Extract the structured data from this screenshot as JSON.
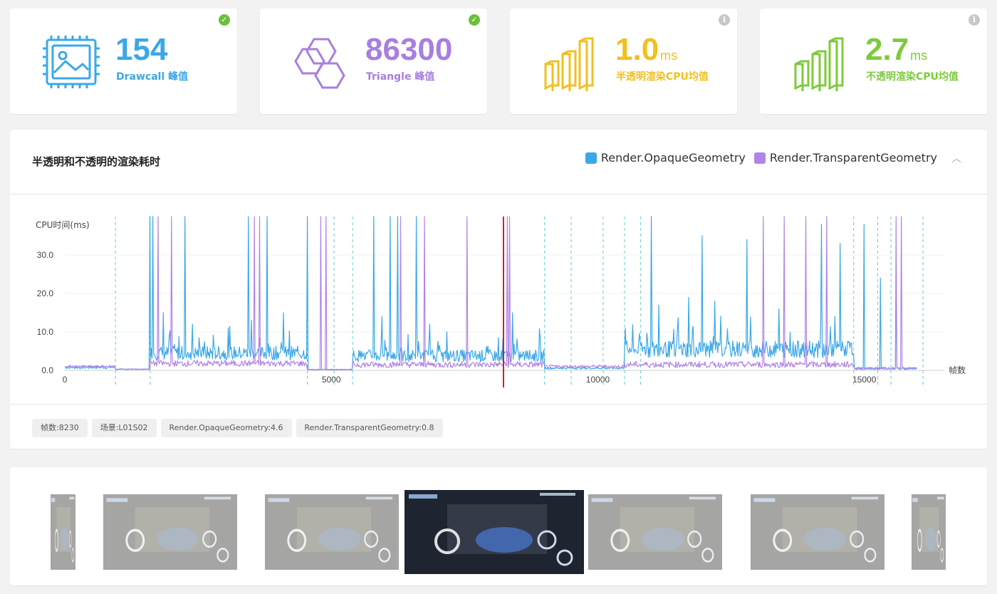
{
  "stats": [
    {
      "value": "154",
      "unit": "",
      "label": "Drawcall 峰值",
      "color": "#3aa8e8",
      "badge": "ok",
      "icon": "image-chip-icon"
    },
    {
      "value": "86300",
      "unit": "",
      "label": "Triangle 峰值",
      "color": "#a87fe0",
      "badge": "ok",
      "icon": "hexagon-cluster-icon"
    },
    {
      "value": "1.0",
      "unit": "ms",
      "label": "半透明渲染CPU均值",
      "color": "#f0c020",
      "badge": "info",
      "icon": "bar-graph-icon"
    },
    {
      "value": "2.7",
      "unit": "ms",
      "label": "不透明渲染CPU均值",
      "color": "#7ccb3a",
      "badge": "info",
      "icon": "bar-graph-icon"
    }
  ],
  "chart": {
    "title": "半透明和不透明的渲染耗时",
    "legend": [
      "Render.OpaqueGeometry",
      "Render.TransparentGeometry"
    ],
    "colors": {
      "opaque": "#3aa8e8",
      "transparent": "#b084e8",
      "marker": "#d42020",
      "dashed": "#5ed0c8"
    }
  },
  "chart_data": {
    "type": "line",
    "ylabel": "CPU时间(ms)",
    "xlabel": "帧数",
    "ylim": [
      0,
      40
    ],
    "xlim": [
      0,
      16000
    ],
    "yticks": [
      "0.0",
      "10.0",
      "20.0",
      "30.0"
    ],
    "xticks": [
      "0",
      "5000",
      "10000",
      "15000"
    ],
    "marker_x": 8230,
    "scene_boundaries": [
      950,
      1600,
      9500,
      4550,
      5050,
      5400,
      9000,
      10100,
      10500,
      10800,
      14800,
      15250,
      15500,
      16100
    ],
    "series": [
      {
        "name": "Render.OpaqueGeometry",
        "segments": [
          {
            "start": 0,
            "end": 950,
            "base": 0.8,
            "noise": 0.4
          },
          {
            "start": 950,
            "end": 1600,
            "base": 0.3,
            "noise": 0.1
          },
          {
            "start": 1600,
            "end": 4550,
            "base": 4.5,
            "noise": 1.8
          },
          {
            "start": 4550,
            "end": 5400,
            "base": 0.2,
            "noise": 0.1
          },
          {
            "start": 5400,
            "end": 9000,
            "base": 3.8,
            "noise": 1.6
          },
          {
            "start": 9000,
            "end": 10500,
            "base": 0.6,
            "noise": 0.3
          },
          {
            "start": 10500,
            "end": 14800,
            "base": 5.5,
            "noise": 2.2
          },
          {
            "start": 14800,
            "end": 16000,
            "base": 0.5,
            "noise": 0.3
          }
        ],
        "spikes": [
          [
            1600,
            40
          ],
          [
            1650,
            40
          ],
          [
            1850,
            15
          ],
          [
            2250,
            40
          ],
          [
            2400,
            12
          ],
          [
            3450,
            40
          ],
          [
            3500,
            13
          ],
          [
            3800,
            40
          ],
          [
            4100,
            15
          ],
          [
            4550,
            40
          ],
          [
            5800,
            40
          ],
          [
            5950,
            14
          ],
          [
            6100,
            40
          ],
          [
            6250,
            40
          ],
          [
            6600,
            40
          ],
          [
            6850,
            12
          ],
          [
            8400,
            15
          ],
          [
            11000,
            40
          ],
          [
            11150,
            17
          ],
          [
            11500,
            11
          ],
          [
            11700,
            19
          ],
          [
            11950,
            35
          ],
          [
            12200,
            18
          ],
          [
            12800,
            34
          ],
          [
            13400,
            16
          ],
          [
            14200,
            38
          ],
          [
            14550,
            33
          ],
          [
            15000,
            38
          ],
          [
            15300,
            24
          ],
          [
            15600,
            24
          ],
          [
            16150,
            18
          ]
        ]
      },
      {
        "name": "Render.TransparentGeometry",
        "segments": [
          {
            "start": 0,
            "end": 950,
            "base": 1.0,
            "noise": 0.3
          },
          {
            "start": 950,
            "end": 1600,
            "base": 0.3,
            "noise": 0.1
          },
          {
            "start": 1600,
            "end": 4550,
            "base": 1.8,
            "noise": 0.8
          },
          {
            "start": 4550,
            "end": 5400,
            "base": 0.2,
            "noise": 0.1
          },
          {
            "start": 5400,
            "end": 9000,
            "base": 1.5,
            "noise": 0.8
          },
          {
            "start": 9000,
            "end": 10500,
            "base": 1.0,
            "noise": 0.4
          },
          {
            "start": 10500,
            "end": 14800,
            "base": 1.5,
            "noise": 0.8
          },
          {
            "start": 14800,
            "end": 16000,
            "base": 0.5,
            "noise": 0.3
          }
        ],
        "spikes": [
          [
            1750,
            40
          ],
          [
            2000,
            40
          ],
          [
            3550,
            40
          ],
          [
            3650,
            40
          ],
          [
            4800,
            40
          ],
          [
            4900,
            40
          ],
          [
            6300,
            40
          ],
          [
            6750,
            40
          ],
          [
            7550,
            40
          ],
          [
            8300,
            40
          ],
          [
            8350,
            40
          ],
          [
            13100,
            40
          ],
          [
            13500,
            40
          ],
          [
            13900,
            40
          ],
          [
            14300,
            40
          ],
          [
            15600,
            40
          ],
          [
            15700,
            40
          ],
          [
            16000,
            40
          ]
        ]
      }
    ]
  },
  "tags": [
    "帧数:8230",
    "场景:L01S02",
    "Render.OpaqueGeometry:4.6",
    "Render.TransparentGeometry:0.8"
  ],
  "screenshots": [
    {
      "name": "screenshot-1",
      "selected": false
    },
    {
      "name": "screenshot-2",
      "selected": false
    },
    {
      "name": "screenshot-3",
      "selected": false
    },
    {
      "name": "screenshot-4",
      "selected": true
    },
    {
      "name": "screenshot-5",
      "selected": false
    },
    {
      "name": "screenshot-6",
      "selected": false
    },
    {
      "name": "screenshot-7",
      "selected": false
    }
  ]
}
